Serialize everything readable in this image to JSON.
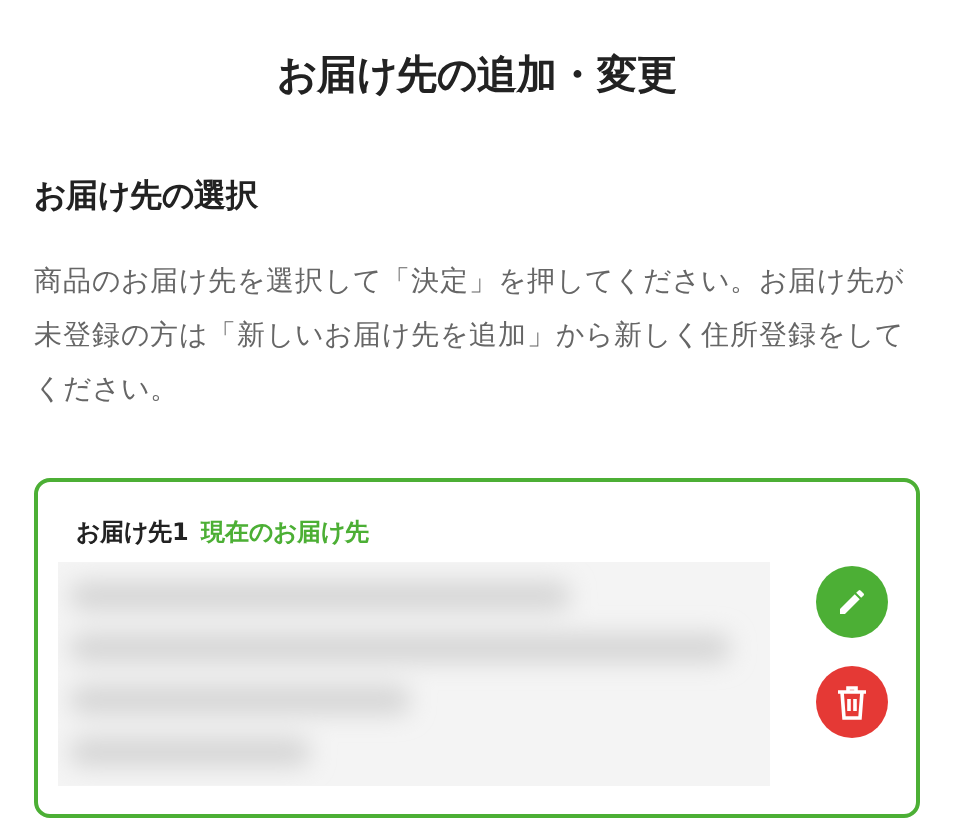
{
  "title": "お届け先の追加・変更",
  "section": {
    "heading": "お届け先の選択",
    "description": "商品のお届け先を選択して「決定」を押してください。お届け先が未登録の方は「新しいお届け先を追加」から新しく住所登録をしてください。"
  },
  "addresses": [
    {
      "label": "お届け先1",
      "badge": "現在のお届け先",
      "selected": true
    }
  ]
}
